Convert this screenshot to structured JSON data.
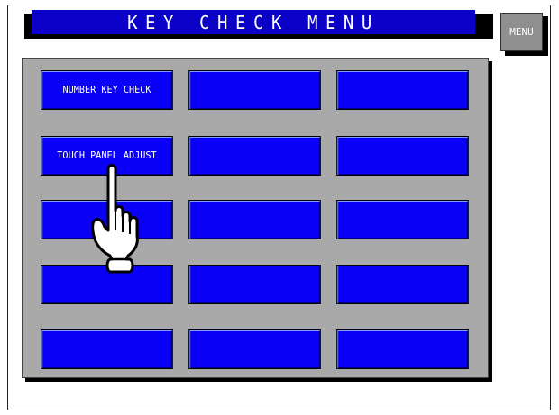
{
  "title": "KEY CHECK MENU",
  "menu_label": "MENU",
  "keys": [
    [
      "NUMBER KEY CHECK",
      "",
      ""
    ],
    [
      "TOUCH PANEL ADJUST",
      "",
      ""
    ],
    [
      "",
      "",
      ""
    ],
    [
      "",
      "",
      ""
    ],
    [
      "",
      "",
      ""
    ]
  ],
  "colors": {
    "title_bar": "#0a00c8",
    "key": "#0a00f8",
    "panel": "#a9a9a9",
    "menu_button": "#8f8f8f"
  },
  "icons": {
    "pointer": "pointing-hand-icon"
  }
}
